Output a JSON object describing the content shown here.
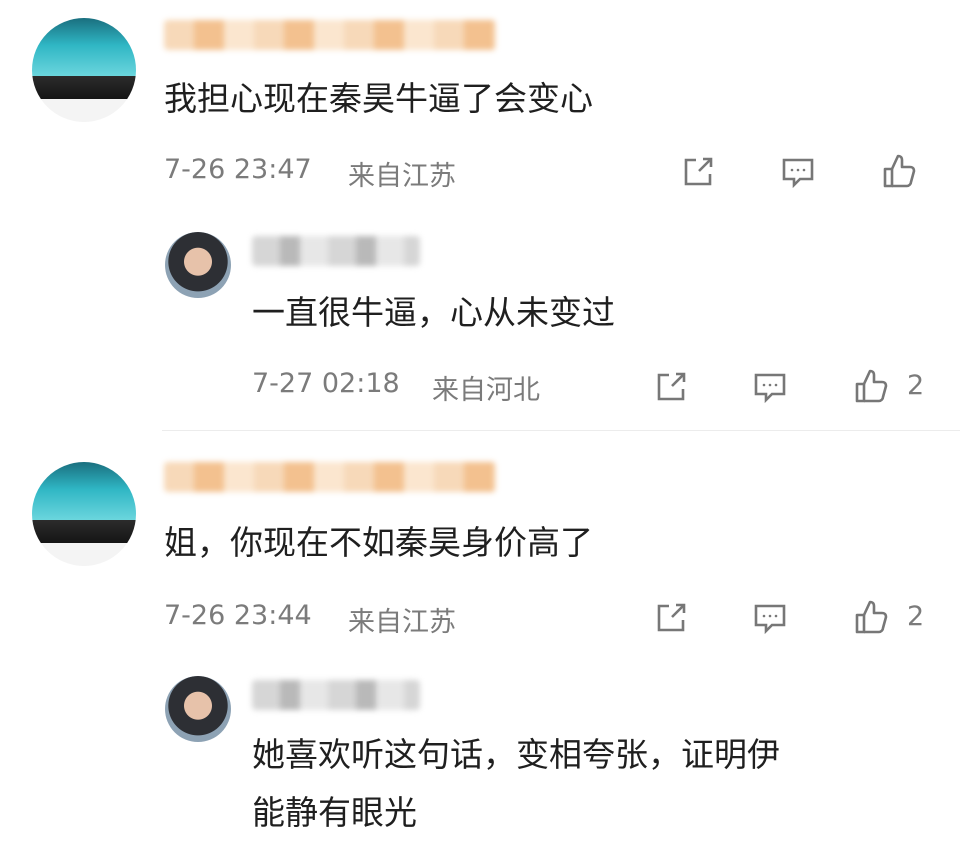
{
  "comments": [
    {
      "text": "我担心现在秦昊牛逼了会变心",
      "time": "7-26 23:47",
      "location": "来自江苏",
      "like_count": "",
      "reply": {
        "text": "一直很牛逼，心从未变过",
        "time": "7-27 02:18",
        "location": "来自河北",
        "like_count": "2"
      }
    },
    {
      "text": "姐，你现在不如秦昊身价高了",
      "time": "7-26 23:44",
      "location": "来自江苏",
      "like_count": "2",
      "reply": {
        "text_line1": "她喜欢听这句话，变相夸张，证明伊",
        "text_line2": "能静有眼光",
        "time": "",
        "location": "",
        "like_count": ""
      }
    }
  ],
  "icons": {
    "share": "share-icon",
    "comment": "comment-icon",
    "like": "thumbs-up-icon"
  },
  "colors": {
    "text": "#1f1f1f",
    "meta": "#7b7b7b"
  }
}
